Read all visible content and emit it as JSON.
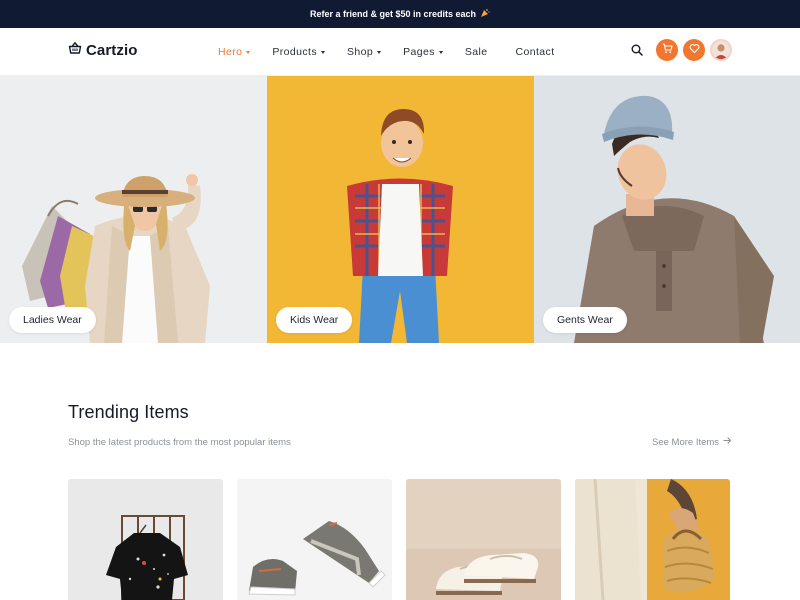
{
  "topbar": {
    "promo_text": "Refer a friend & get $50 in credits each",
    "icon": "party-popper-icon"
  },
  "header": {
    "brand": "Cartzio",
    "brand_icon": "shopping-basket-icon",
    "menu": [
      {
        "label": "Hero",
        "dropdown": true,
        "active": true
      },
      {
        "label": "Products",
        "dropdown": true,
        "active": false
      },
      {
        "label": "Shop",
        "dropdown": true,
        "active": false
      },
      {
        "label": "Pages",
        "dropdown": true,
        "active": false
      },
      {
        "label": "Sale",
        "dropdown": false,
        "active": false
      },
      {
        "label": "Contact",
        "dropdown": false,
        "active": false
      }
    ],
    "icons": [
      "search-icon",
      "cart-icon",
      "heart-icon",
      "user-avatar"
    ]
  },
  "hero": {
    "categories": [
      {
        "label": "Ladies Wear",
        "background": "#eceef0"
      },
      {
        "label": "Kids Wear",
        "background": "#f2b835"
      },
      {
        "label": "Gents Wear",
        "background": "#dde3e7"
      }
    ]
  },
  "trending": {
    "title": "Trending Items",
    "subtitle": "Shop the latest products from the most popular items",
    "see_more": "See More Items"
  },
  "colors": {
    "accent": "#f2762e",
    "topbar_bg": "#101a32",
    "text_dark": "#141a2b",
    "text_muted": "#8b909a"
  }
}
